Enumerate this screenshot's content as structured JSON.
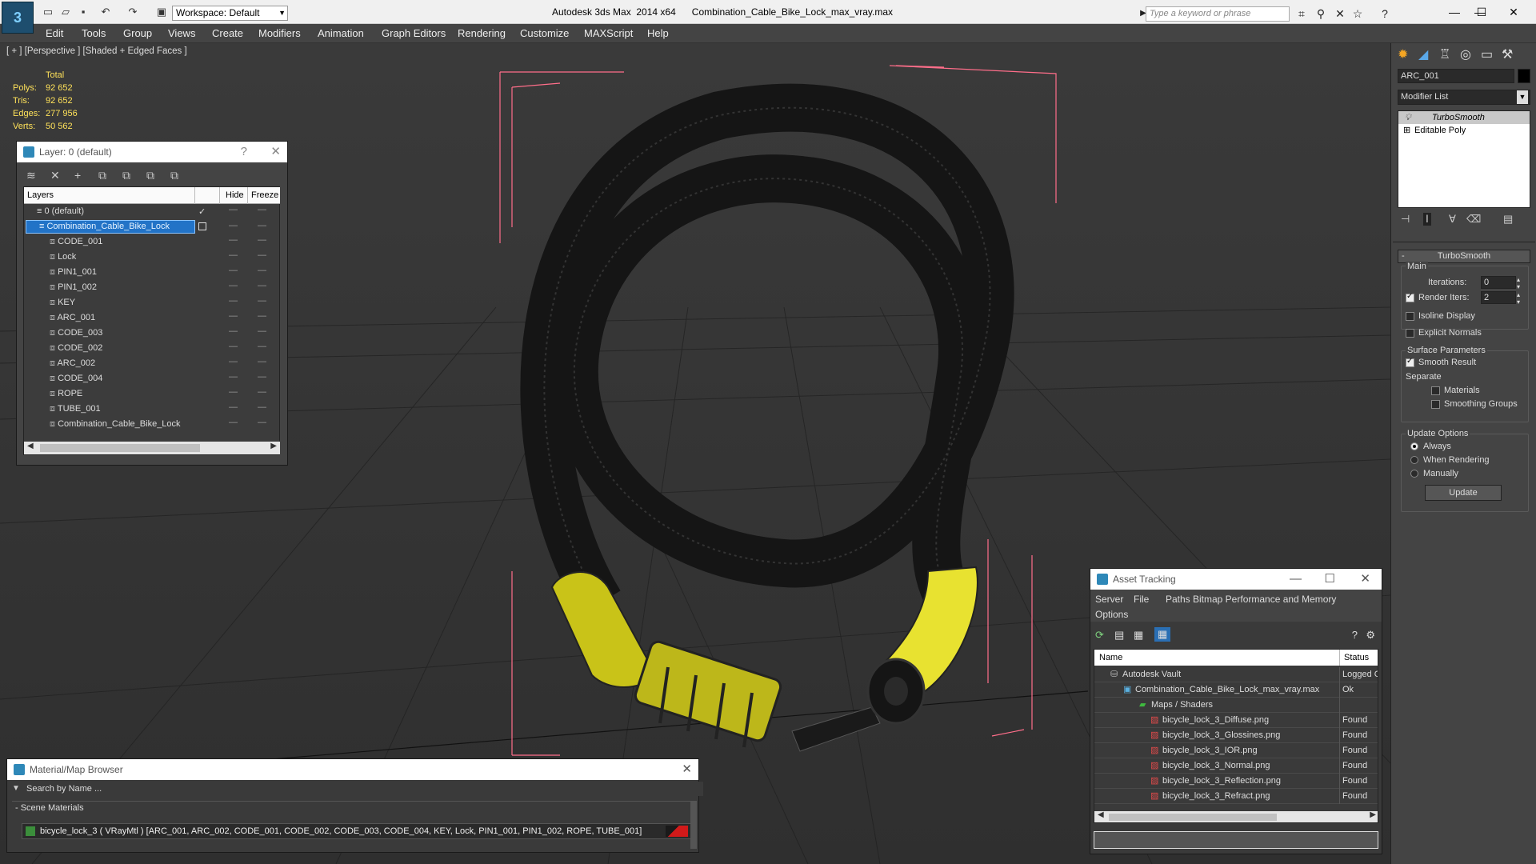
{
  "titlebar": {
    "workspace": "Workspace: Default",
    "app_title": "Autodesk 3ds Max  2014 x64",
    "file_name": "Combination_Cable_Bike_Lock_max_vray.max",
    "search_placeholder": "Type a keyword or phrase"
  },
  "menu": [
    "Edit",
    "Tools",
    "Group",
    "Views",
    "Create",
    "Modifiers",
    "Animation",
    "Graph Editors",
    "Rendering",
    "Customize",
    "MAXScript",
    "Help"
  ],
  "viewport": {
    "label": "[ + ] [Perspective ] [Shaded + Edged Faces ]",
    "stats": {
      "total_label": "Total",
      "polys_label": "Polys:",
      "polys": "92 652",
      "tris_label": "Tris:",
      "tris": "92 652",
      "edges_label": "Edges:",
      "edges": "277 956",
      "verts_label": "Verts:",
      "verts": "50 562"
    }
  },
  "layer_dialog": {
    "title": "Layer: 0 (default)",
    "help": "?",
    "columns": [
      "Layers",
      "Hide",
      "Freeze"
    ],
    "default_layer": "0 (default)",
    "selected_layer": "Combination_Cable_Bike_Lock",
    "objects": [
      "CODE_001",
      "Lock",
      "PIN1_001",
      "PIN1_002",
      "KEY",
      "ARC_001",
      "CODE_003",
      "CODE_002",
      "ARC_002",
      "CODE_004",
      "ROPE",
      "TUBE_001",
      "Combination_Cable_Bike_Lock"
    ]
  },
  "command_panel": {
    "object_name": "ARC_001",
    "modifier_list": "Modifier List",
    "stack": [
      "TurboSmooth",
      "Editable Poly"
    ],
    "rollout_title": "TurboSmooth",
    "main_label": "Main",
    "iterations_label": "Iterations:",
    "iterations": "0",
    "render_iters_label": "Render Iters:",
    "render_iters": "2",
    "isoline": "Isoline Display",
    "explicit_normals": "Explicit Normals",
    "surface_params": "Surface Parameters",
    "smooth_result": "Smooth Result",
    "separate": "Separate",
    "materials": "Materials",
    "smoothing_groups": "Smoothing Groups",
    "update_options": "Update Options",
    "always": "Always",
    "when_rendering": "When Rendering",
    "manually": "Manually",
    "update_button": "Update"
  },
  "asset_tracking": {
    "title": "Asset Tracking",
    "menu": [
      "Server",
      "File",
      "Paths",
      "Bitmap Performance and Memory",
      "Options"
    ],
    "columns": [
      "Name",
      "Status"
    ],
    "rows": [
      {
        "name": "Autodesk Vault",
        "status": "Logged C"
      },
      {
        "name": "Combination_Cable_Bike_Lock_max_vray.max",
        "status": "Ok"
      },
      {
        "name": "Maps / Shaders",
        "status": ""
      },
      {
        "name": "bicycle_lock_3_Diffuse.png",
        "status": "Found"
      },
      {
        "name": "bicycle_lock_3_Glossines.png",
        "status": "Found"
      },
      {
        "name": "bicycle_lock_3_IOR.png",
        "status": "Found"
      },
      {
        "name": "bicycle_lock_3_Normal.png",
        "status": "Found"
      },
      {
        "name": "bicycle_lock_3_Reflection.png",
        "status": "Found"
      },
      {
        "name": "bicycle_lock_3_Refract.png",
        "status": "Found"
      }
    ]
  },
  "material_browser": {
    "title": "Material/Map Browser",
    "search_placeholder": "Search by Name ...",
    "section": "- Scene Materials",
    "material": "bicycle_lock_3  ( VRayMtl ) [ARC_001, ARC_002, CODE_001, CODE_002, CODE_003, CODE_004, KEY, Lock, PIN1_001, PIN1_002, ROPE, TUBE_001]"
  }
}
